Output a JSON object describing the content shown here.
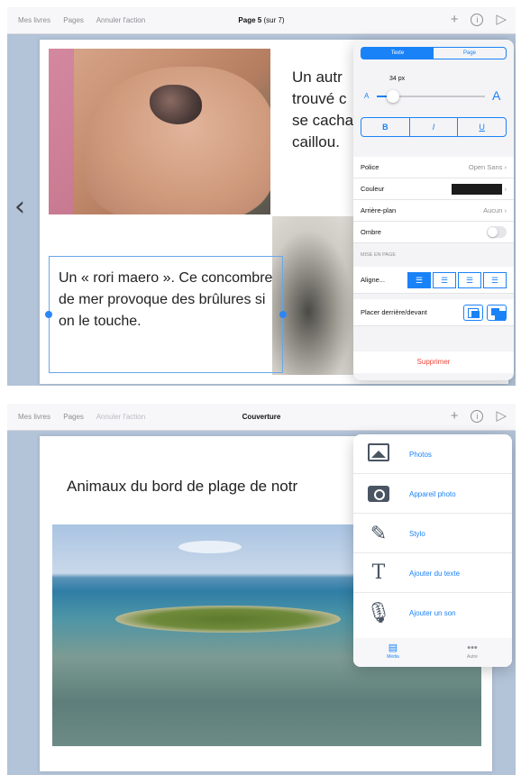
{
  "screen1": {
    "toolbar": {
      "my_books": "Mes livres",
      "pages": "Pages",
      "undo": "Annuler l'action",
      "page_title": "Page 5",
      "page_sub": "(sur 7)",
      "add_icon": "plus-icon",
      "info_icon": "info-icon",
      "play_icon": "play-icon"
    },
    "page": {
      "text_top_lines": [
        "Un autr",
        "trouvé c",
        "se cacha",
        "caillou."
      ],
      "text_box": "Un « rori maero ». Ce concombre de mer provoque des brûlures si on le touche."
    },
    "format_panel": {
      "tab_text": "Texte",
      "tab_page": "Page",
      "font_size": "34 px",
      "font_size_fraction": 0.15,
      "small_a": "A",
      "big_a": "A",
      "bold": "B",
      "italic": "I",
      "underline": "U",
      "font_label": "Police",
      "font_value": "Open Sans",
      "color_label": "Couleur",
      "color_value": "#1c1c1c",
      "background_label": "Arrière-plan",
      "background_value": "Aucun",
      "shadow_label": "Ombre",
      "layout_section": "MISE EN PAGE",
      "align_label": "Aligne...",
      "layer_label": "Placer derrière/devant",
      "delete_label": "Supprimer"
    }
  },
  "screen2": {
    "toolbar": {
      "my_books": "Mes livres",
      "pages": "Pages",
      "undo": "Annuler l'action",
      "page_title": "Couverture"
    },
    "page": {
      "title": "Animaux du bord de plage de notr"
    },
    "add_menu": {
      "items": [
        {
          "label": "Photos",
          "icon": "photo-icon"
        },
        {
          "label": "Appareil photo",
          "icon": "camera-icon"
        },
        {
          "label": "Stylo",
          "icon": "pen-icon"
        },
        {
          "label": "Ajouter du texte",
          "icon": "text-icon"
        },
        {
          "label": "Ajouter un son",
          "icon": "microphone-icon"
        }
      ],
      "tab_media": "Média",
      "tab_other": "Autre"
    }
  },
  "accent": "#1a82f7",
  "danger": "#f0463c"
}
